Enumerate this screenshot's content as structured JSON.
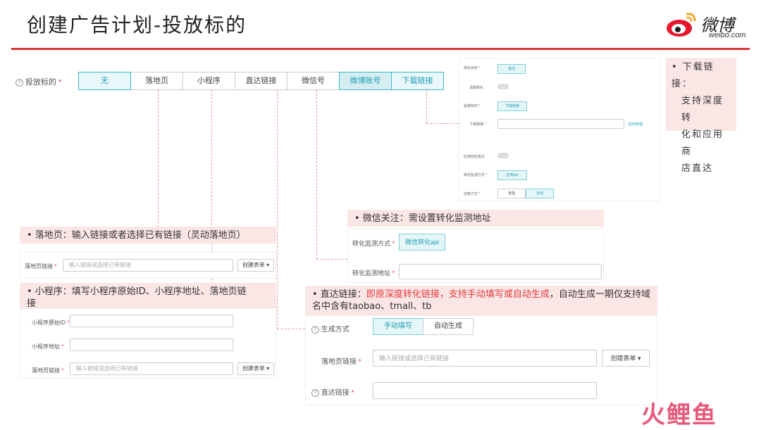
{
  "page": {
    "title": "创建广告计划-投放标的",
    "logo_text": "微博",
    "logo_sub": "weibo.com",
    "watermark": "火鲤鱼"
  },
  "target": {
    "label": "投放标的",
    "tabs": [
      "无",
      "落地页",
      "小程序",
      "直达链接",
      "微信号",
      "微博账号",
      "下载链接"
    ]
  },
  "notes": {
    "download": [
      "• 下载链接：",
      "支持深度转",
      "化和应用商",
      "店直达"
    ],
    "landing": "• 落地页：输入链接或者选择已有链接（灵动落地页）",
    "miniprogram": "• 小程序：填写小程序原始ID、小程序地址、落地页链接",
    "wechat": "• 微信关注：需设置转化监测地址",
    "direct_prefix": "• 直达链接：",
    "direct_red": "即原深度转化链接，支持手动填写或自动生成",
    "direct_suffix": "，自动生成一期仅支持域名中含有taobao、tmall、tb"
  },
  "landing_form": {
    "label": "落地页链接",
    "placeholder": "输入链接或选择已有链接",
    "create_btn": "创建表单 ▾"
  },
  "mini_form": {
    "id_label": "小程序原始ID",
    "addr_label": "小程序地址",
    "landing_label": "落地页链接",
    "placeholder": "输入链接或选择已有链接",
    "create_btn": "创建表单 ▾"
  },
  "wechat_form": {
    "method_label": "转化监测方式",
    "method_btn": "微信转化api",
    "addr_label": "转化监测地址"
  },
  "direct_form": {
    "gen_label": "生成方式",
    "gen_manual": "手动填写",
    "gen_auto": "自动生成",
    "landing_label": "落地页链接",
    "placeholder": "输入链接或选择已有链接",
    "create_btn": "创建表单 ▾",
    "direct_label": "直达链接"
  },
  "download_panel": {
    "row1_label": "转化目标",
    "row1_btn": "激活",
    "row2_label": "深度转化",
    "row3_label": "投放标的",
    "row3_btn": "下载链接",
    "row4_label": "下载链接",
    "row4_link": "应用管理",
    "row5_label": "应用商店直达",
    "row6_label": "转化监测方式",
    "row6_btn": "应用api",
    "row7_label": "创意方式",
    "row7_opt1": "自选",
    "row7_opt2": "互动"
  }
}
